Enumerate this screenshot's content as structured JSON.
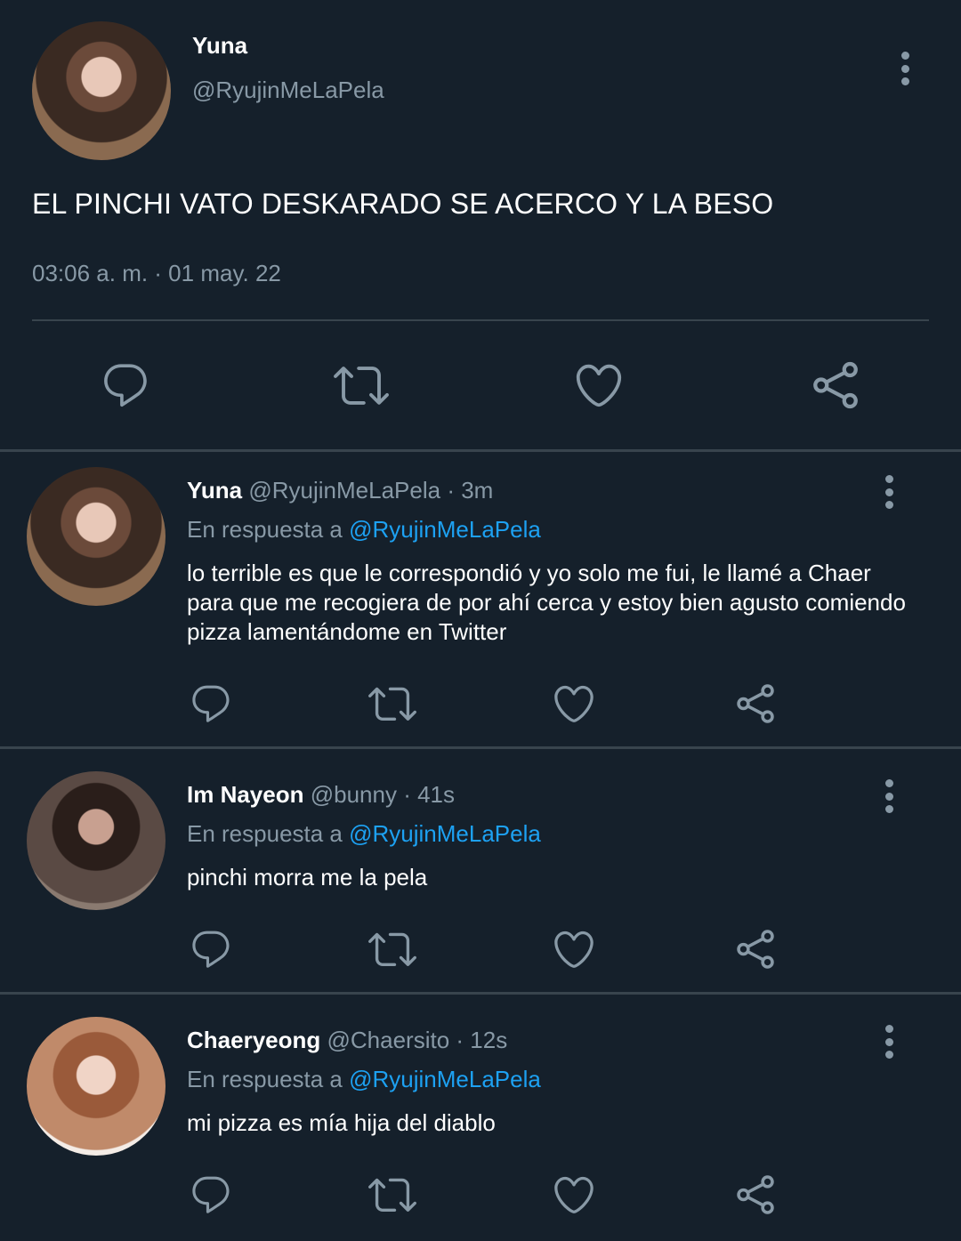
{
  "main_tweet": {
    "name": "Yuna",
    "handle": "@RyujinMeLaPela",
    "text": "EL PINCHI VATO DESKARADO SE ACERCO Y LA BESO",
    "timestamp": "03:06 a. m. · 01 may. 22"
  },
  "replies": [
    {
      "name": "Yuna",
      "meta": "@RyujinMeLaPela · 3m",
      "reply_prefix": "En respuesta a ",
      "reply_to": "@RyujinMeLaPela",
      "text": "lo terrible es que le correspondió y yo solo me fui, le llamé a Chaer para que me recogiera de por ahí cerca y estoy bien agusto comiendo pizza lamentándome en Twitter"
    },
    {
      "name": "Im Nayeon",
      "meta": "@bunny · 41s",
      "reply_prefix": "En respuesta a ",
      "reply_to": "@RyujinMeLaPela",
      "text": "pinchi morra me la pela"
    },
    {
      "name": "Chaeryeong",
      "meta": "@Chaersito · 12s",
      "reply_prefix": "En respuesta a ",
      "reply_to": "@RyujinMeLaPela",
      "text": "mi pizza es mía hija del diablo"
    }
  ],
  "icons": {
    "reply": "reply-icon",
    "retweet": "retweet-icon",
    "like": "heart-icon",
    "share": "share-icon",
    "more": "more-vertical-icon"
  },
  "colors": {
    "background": "#15202b",
    "secondary_text": "#8899a6",
    "link": "#1da1f2",
    "divider": "#38444d"
  }
}
